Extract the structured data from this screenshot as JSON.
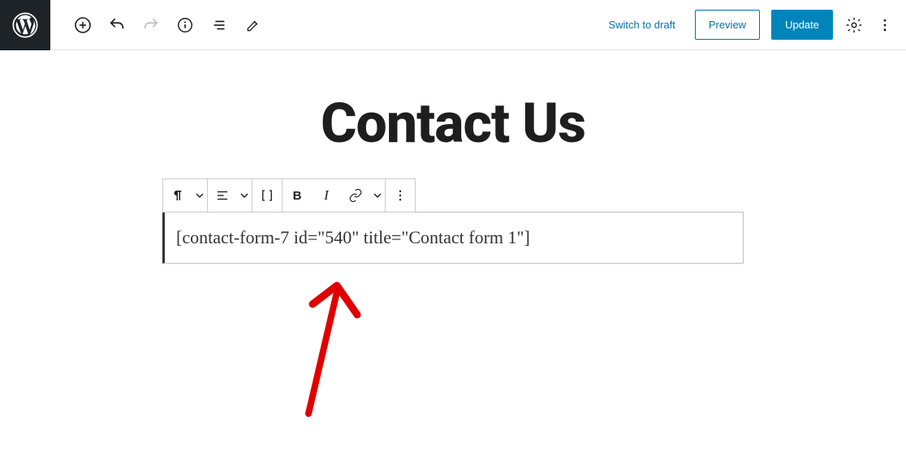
{
  "header": {
    "switch_to_draft": "Switch to draft",
    "preview": "Preview",
    "update": "Update"
  },
  "editor": {
    "title": "Contact Us",
    "block_text": "[contact-form-7 id=\"540\" title=\"Contact form 1\"]"
  },
  "block_toolbar": {
    "bold": "B",
    "italic": "I"
  }
}
